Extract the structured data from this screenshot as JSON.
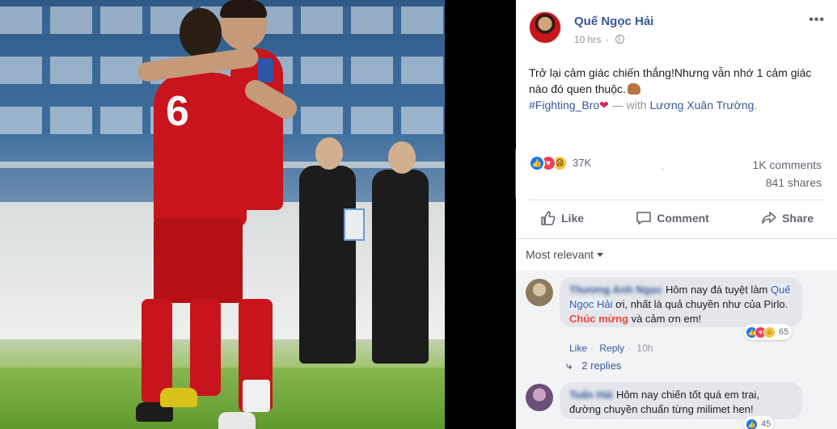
{
  "post": {
    "author": "Quế Ngọc Hải",
    "time": "10 hrs",
    "separator": "·",
    "more_label": "•••",
    "text_line1": "Trở lại cảm giác chiến thắng!Nhưng vẫn nhớ 1 cảm giác nào đó quen thuộc.",
    "hashtag": "#Fighting_Bro",
    "with_label": "— with",
    "tagged": "Lương Xuân Trường",
    "period": ".",
    "jersey_number": "6"
  },
  "stats": {
    "reaction_count": "37K",
    "comments": "1K comments",
    "shares": "841 shares",
    "dot": "."
  },
  "actions": {
    "like": "Like",
    "comment": "Comment",
    "share": "Share"
  },
  "sort": {
    "label": "Most relevant"
  },
  "comments": [
    {
      "name": "Thương Anh Ngọc",
      "text_a": "Hôm nay đá tuyệt làm",
      "mention": "Quế Ngọc Hải",
      "text_b": "ơi, nhất là quả chuyền như của Pirlo.",
      "highlight": "Chúc mừng",
      "text_c": "và cảm ơn em!",
      "reaction_count": "65",
      "like": "Like",
      "reply": "Reply",
      "dot": "·",
      "time": "10h",
      "replies": "2 replies"
    },
    {
      "name": "Tuấn Hải",
      "text_a": "Hôm nay chiến tốt quá em trai, đường chuyền chuẩn từng milimet hen!",
      "reaction_count": "45"
    }
  ]
}
